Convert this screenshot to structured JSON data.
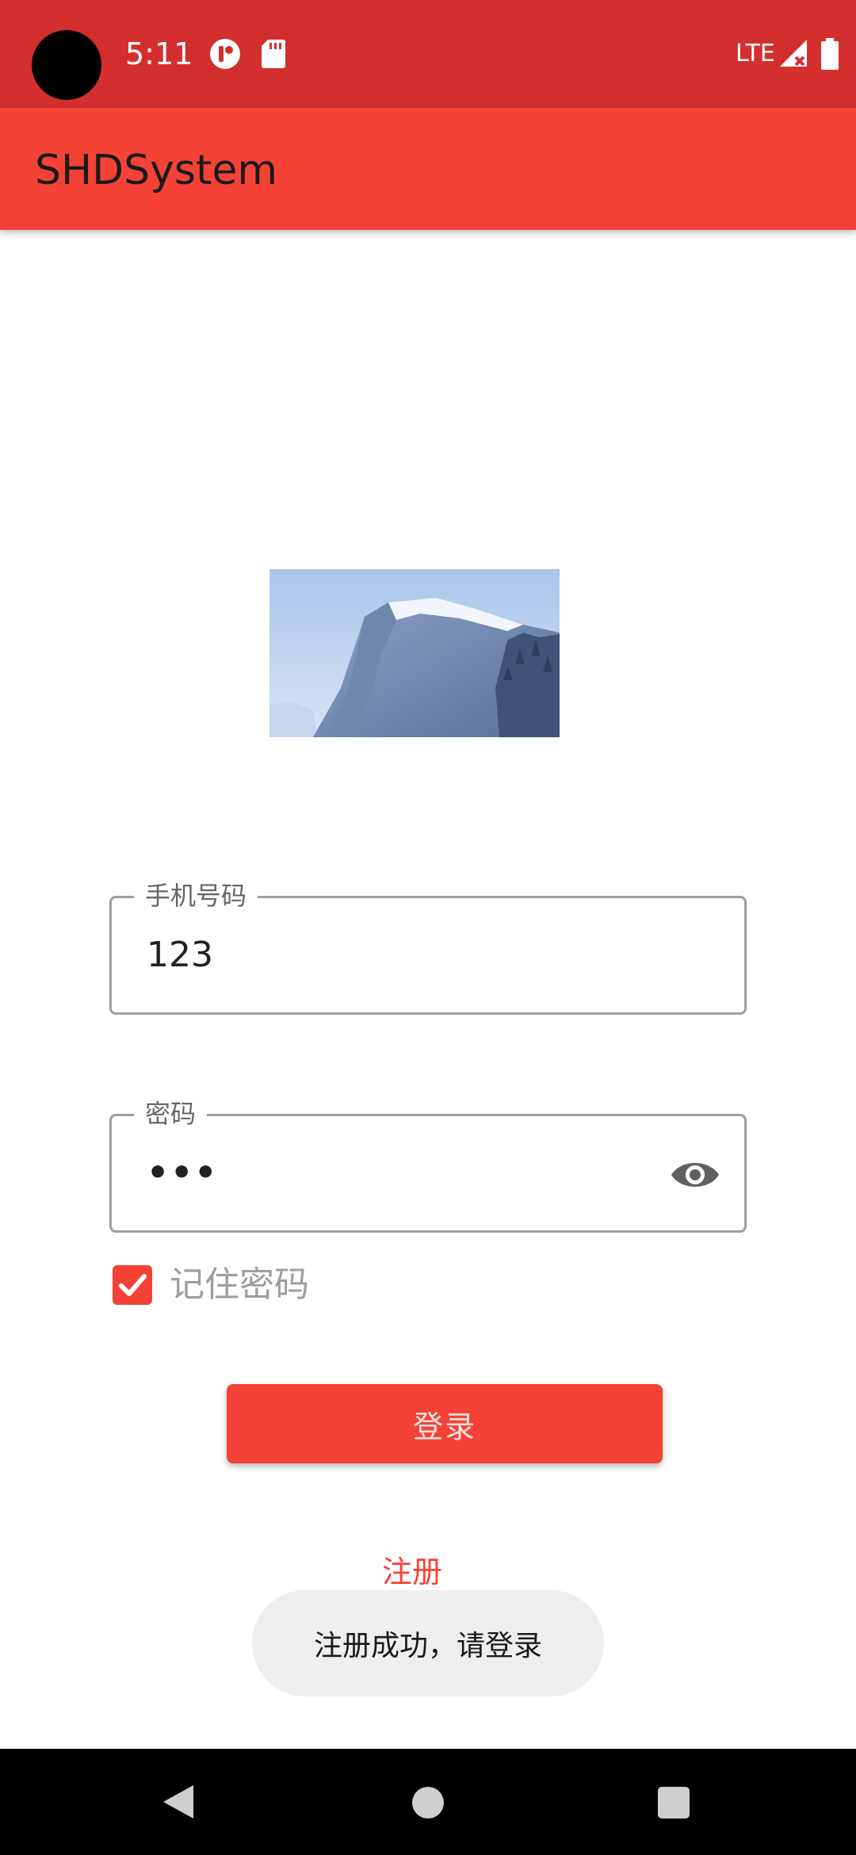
{
  "status_bar": {
    "time": "5:11",
    "network": "LTE",
    "icons": [
      "app-notification-icon",
      "sd-card-icon",
      "signal-icon",
      "battery-icon"
    ]
  },
  "app_bar": {
    "title": "SHDSystem"
  },
  "form": {
    "phone_label": "手机号码",
    "phone_value": "123",
    "password_label": "密码",
    "password_value": "•••",
    "remember_label": "记住密码",
    "remember_checked": true,
    "login_label": "登录",
    "register_label": "注册"
  },
  "toast": {
    "message": "注册成功，请登录"
  },
  "colors": {
    "status_bar": "#d32f2f",
    "primary": "#f44336",
    "toast_bg": "#eeeeee"
  }
}
